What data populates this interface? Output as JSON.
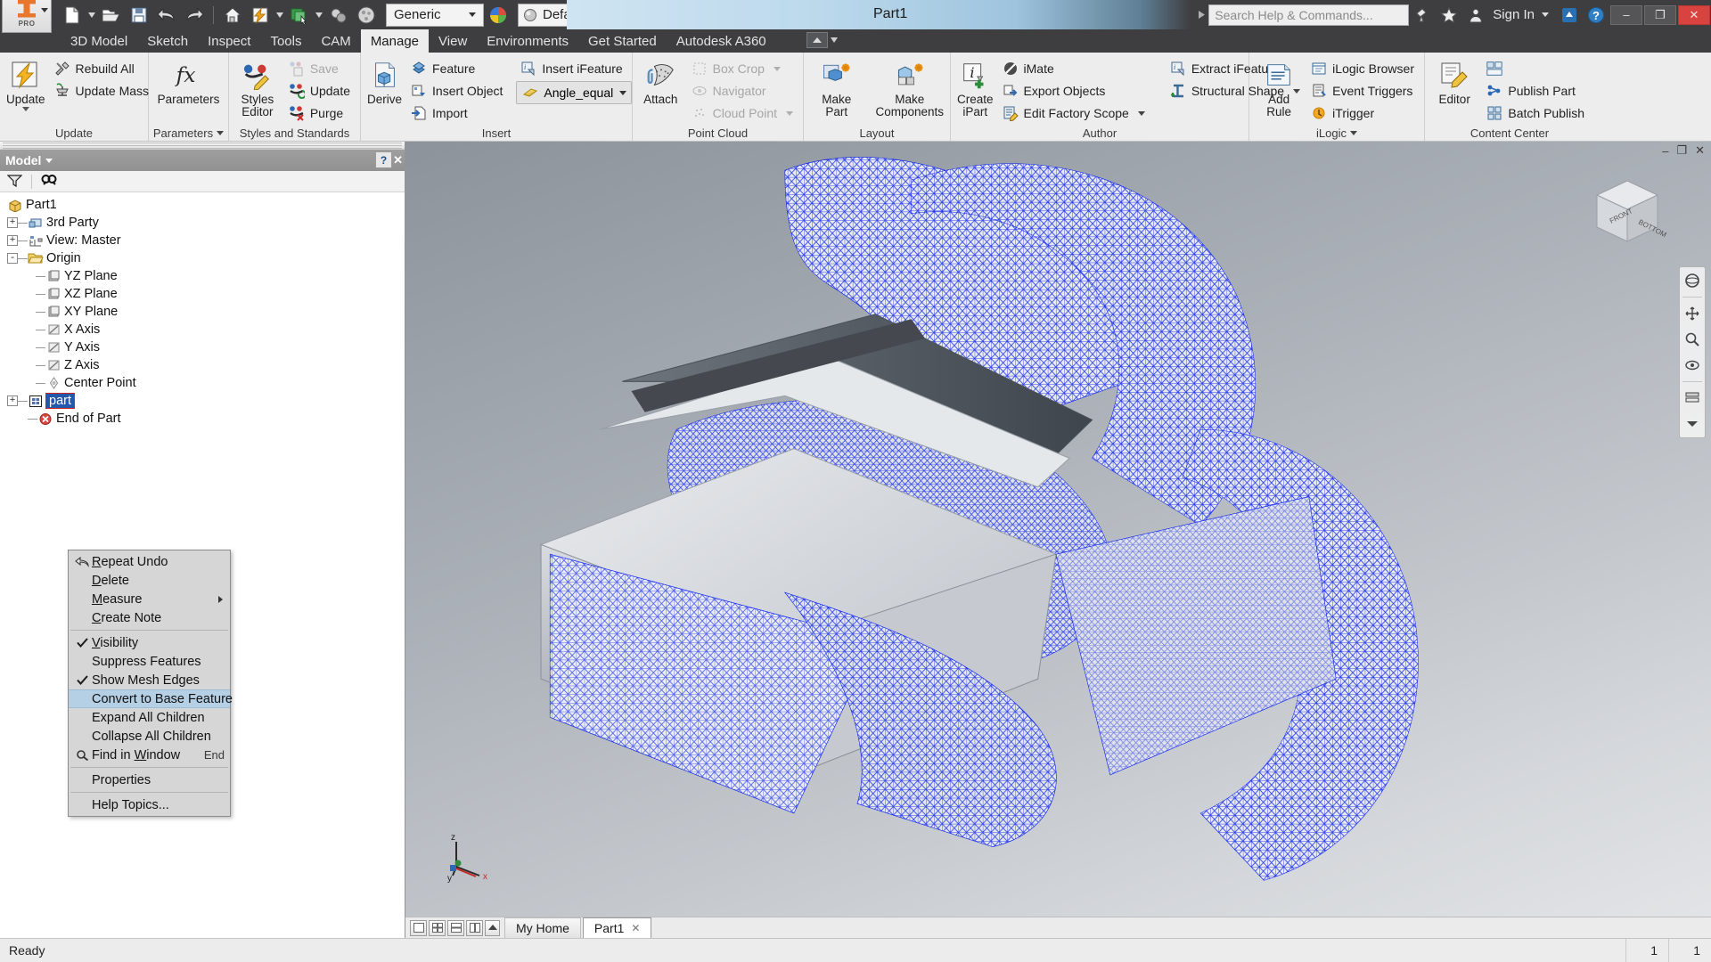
{
  "app": {
    "title": "Part1",
    "logo_label": "PRO"
  },
  "quick_access": {
    "items": [
      {
        "name": "new-file-icon",
        "label": "New"
      },
      {
        "name": "open-file-icon",
        "label": "Open"
      },
      {
        "name": "save-icon",
        "label": "Save"
      },
      {
        "name": "undo-icon",
        "label": "Undo"
      },
      {
        "name": "redo-icon",
        "label": "Redo"
      },
      {
        "name": "home-icon",
        "label": "Home"
      },
      {
        "name": "update-icon",
        "label": "Update"
      },
      {
        "name": "select-icon",
        "label": "Select"
      },
      {
        "name": "appearance-icon",
        "label": "Appearance"
      },
      {
        "name": "material-icon",
        "label": "Material"
      }
    ],
    "material_combo": "Generic",
    "appearance_combo": "Default"
  },
  "titlebar": {
    "search_placeholder": "Search Help & Commands...",
    "sign_in": "Sign In",
    "minimize": "–",
    "maximize": "❐",
    "close": "✕"
  },
  "menu_tabs": [
    {
      "label": "3D Model",
      "active": false
    },
    {
      "label": "Sketch",
      "active": false
    },
    {
      "label": "Inspect",
      "active": false
    },
    {
      "label": "Tools",
      "active": false
    },
    {
      "label": "CAM",
      "active": false
    },
    {
      "label": "Manage",
      "active": true
    },
    {
      "label": "View",
      "active": false
    },
    {
      "label": "Environments",
      "active": false
    },
    {
      "label": "Get Started",
      "active": false
    },
    {
      "label": "Autodesk A360",
      "active": false
    }
  ],
  "ribbon": {
    "panels": [
      {
        "title": "Update",
        "has_dropdown": false,
        "big": [
          {
            "label": "Update",
            "icon": "update-icon",
            "has_caret": true
          }
        ],
        "small": [
          {
            "label": "Rebuild All",
            "icon": "rebuild-all-icon",
            "disabled": false,
            "caret": false
          },
          {
            "label": "Update Mass",
            "icon": "update-mass-icon",
            "disabled": false,
            "caret": false
          }
        ]
      },
      {
        "title": "Parameters",
        "has_dropdown": true,
        "big": [
          {
            "label": "Parameters",
            "icon": "fx-icon",
            "has_caret": false
          }
        ],
        "small": []
      },
      {
        "title": "Styles and Standards",
        "has_dropdown": false,
        "big": [
          {
            "label": "Styles Editor",
            "icon": "styles-editor-icon",
            "has_caret": false
          }
        ],
        "small": [
          {
            "label": "Save",
            "icon": "styles-save-icon",
            "disabled": true,
            "caret": false
          },
          {
            "label": "Update",
            "icon": "styles-update-icon",
            "disabled": false,
            "caret": false
          },
          {
            "label": "Purge",
            "icon": "styles-purge-icon",
            "disabled": false,
            "caret": false
          }
        ]
      },
      {
        "title": "Insert",
        "has_dropdown": false,
        "big": [
          {
            "label": "Derive",
            "icon": "derive-icon",
            "has_caret": false
          }
        ],
        "small": [
          {
            "label": "Feature",
            "icon": "feature-icon",
            "disabled": false,
            "caret": false
          },
          {
            "label": "Insert Object",
            "icon": "insert-object-icon",
            "disabled": false,
            "caret": false
          },
          {
            "label": "Import",
            "icon": "import-icon",
            "disabled": false,
            "caret": false
          }
        ],
        "small2": [
          {
            "label": "Insert iFeature",
            "icon": "insert-ifeature-icon",
            "disabled": false,
            "caret": false
          }
        ],
        "pill": {
          "label": "Angle_equal",
          "icon": "ifeature-yellow-icon"
        }
      },
      {
        "title": "Point Cloud",
        "has_dropdown": false,
        "big": [
          {
            "label": "Attach",
            "icon": "attach-icon",
            "has_caret": false
          }
        ],
        "small": [
          {
            "label": "Box Crop",
            "icon": "box-crop-icon",
            "disabled": true,
            "caret": true
          },
          {
            "label": "Navigator",
            "icon": "navigator-icon",
            "disabled": true,
            "caret": false
          },
          {
            "label": "Cloud Point",
            "icon": "cloud-point-icon",
            "disabled": true,
            "caret": true
          }
        ]
      },
      {
        "title": "Layout",
        "has_dropdown": false,
        "big": [
          {
            "label": "Make Part",
            "icon": "make-part-icon",
            "has_caret": false
          },
          {
            "label": "Make Components",
            "icon": "make-components-icon",
            "has_caret": false
          }
        ],
        "small": []
      },
      {
        "title": "Author",
        "has_dropdown": false,
        "big": [
          {
            "label": "Create iPart",
            "icon": "create-ipart-icon",
            "has_caret": false
          }
        ],
        "small": [
          {
            "label": "iMate",
            "icon": "imate-icon",
            "disabled": false,
            "caret": false
          },
          {
            "label": "Export Objects",
            "icon": "export-objects-icon",
            "disabled": false,
            "caret": false
          },
          {
            "label": "Edit Factory Scope",
            "icon": "edit-factory-scope-icon",
            "disabled": false,
            "caret": true
          }
        ],
        "small2": [
          {
            "label": "Extract iFeature",
            "icon": "extract-ifeature-icon",
            "disabled": false,
            "caret": false
          },
          {
            "label": "Structural Shape",
            "icon": "structural-shape-icon",
            "disabled": false,
            "caret": true
          }
        ]
      },
      {
        "title": "iLogic",
        "has_dropdown": true,
        "big": [
          {
            "label": "Add Rule",
            "icon": "add-rule-icon",
            "has_caret": false
          }
        ],
        "small": [
          {
            "label": "iLogic Browser",
            "icon": "ilogic-browser-icon",
            "disabled": false,
            "caret": false
          },
          {
            "label": "Event Triggers",
            "icon": "event-triggers-icon",
            "disabled": false,
            "caret": false
          },
          {
            "label": "iTrigger",
            "icon": "itrigger-icon",
            "disabled": false,
            "caret": false
          }
        ]
      },
      {
        "title": "Content Center",
        "has_dropdown": false,
        "big": [
          {
            "label": "Editor",
            "icon": "editor-icon",
            "has_caret": false
          }
        ],
        "small": [
          {
            "label": "Publish Part",
            "icon": "publish-part-icon",
            "disabled": false,
            "caret": false
          },
          {
            "label": "Batch Publish",
            "icon": "batch-publish-icon",
            "disabled": false,
            "caret": false
          }
        ],
        "small_top_icon": "content-center-icon"
      }
    ]
  },
  "browser": {
    "panel_title": "Model",
    "help_label": "?",
    "close_label": "✕",
    "tools": [
      {
        "name": "filter-icon",
        "label": "Filter"
      },
      {
        "name": "find-icon",
        "label": "Find"
      }
    ],
    "tree": [
      {
        "label": "Part1",
        "depth": 0,
        "icon": "part-cube-icon",
        "expander": "",
        "selected": false
      },
      {
        "label": "3rd Party",
        "depth": 1,
        "icon": "third-party-icon",
        "expander": "+",
        "selected": false
      },
      {
        "label": "View: Master",
        "depth": 1,
        "icon": "view-master-icon",
        "expander": "+",
        "selected": false
      },
      {
        "label": "Origin",
        "depth": 1,
        "icon": "folder-icon",
        "expander": "-",
        "selected": false
      },
      {
        "label": "YZ Plane",
        "depth": 2,
        "icon": "plane-icon",
        "expander": "",
        "selected": false
      },
      {
        "label": "XZ Plane",
        "depth": 2,
        "icon": "plane-icon",
        "expander": "",
        "selected": false
      },
      {
        "label": "XY Plane",
        "depth": 2,
        "icon": "plane-icon",
        "expander": "",
        "selected": false
      },
      {
        "label": "X Axis",
        "depth": 2,
        "icon": "axis-icon",
        "expander": "",
        "selected": false
      },
      {
        "label": "Y Axis",
        "depth": 2,
        "icon": "axis-icon",
        "expander": "",
        "selected": false
      },
      {
        "label": "Z Axis",
        "depth": 2,
        "icon": "axis-icon",
        "expander": "",
        "selected": false
      },
      {
        "label": "Center Point",
        "depth": 2,
        "icon": "center-point-icon",
        "expander": "",
        "selected": false
      },
      {
        "label": "part",
        "depth": 1,
        "icon": "mesh-feature-icon",
        "expander": "+",
        "selected": true
      },
      {
        "label": "End of Part",
        "depth": 1,
        "icon": "end-of-part-icon",
        "expander": "",
        "selected": false
      }
    ]
  },
  "context_menu": {
    "items": [
      {
        "label": "Repeat Undo",
        "accel": "R",
        "icon": "undo-icon",
        "check": false,
        "shortcut": "",
        "submenu": false,
        "highlight": false,
        "sep_after": false
      },
      {
        "label": "Delete",
        "accel": "D",
        "icon": "",
        "check": false,
        "shortcut": "",
        "submenu": false,
        "highlight": false,
        "sep_after": false
      },
      {
        "label": "Measure",
        "accel": "M",
        "icon": "",
        "check": false,
        "shortcut": "",
        "submenu": true,
        "highlight": false,
        "sep_after": false
      },
      {
        "label": "Create Note",
        "accel": "C",
        "icon": "",
        "check": false,
        "shortcut": "",
        "submenu": false,
        "highlight": false,
        "sep_after": true
      },
      {
        "label": "Visibility",
        "accel": "V",
        "icon": "",
        "check": true,
        "shortcut": "",
        "submenu": false,
        "highlight": false,
        "sep_after": false
      },
      {
        "label": "Suppress Features",
        "accel": "",
        "icon": "",
        "check": false,
        "shortcut": "",
        "submenu": false,
        "highlight": false,
        "sep_after": false
      },
      {
        "label": "Show Mesh Edges",
        "accel": "",
        "icon": "",
        "check": true,
        "shortcut": "",
        "submenu": false,
        "highlight": false,
        "sep_after": false
      },
      {
        "label": "Convert to Base Feature",
        "accel": "",
        "icon": "",
        "check": false,
        "shortcut": "",
        "submenu": false,
        "highlight": true,
        "sep_after": false
      },
      {
        "label": "Expand All Children",
        "accel": "",
        "icon": "",
        "check": false,
        "shortcut": "",
        "submenu": false,
        "highlight": false,
        "sep_after": false
      },
      {
        "label": "Collapse All Children",
        "accel": "",
        "icon": "",
        "check": false,
        "shortcut": "",
        "submenu": false,
        "highlight": false,
        "sep_after": false
      },
      {
        "label": "Find in Window",
        "accel": "W",
        "icon": "find-icon",
        "check": false,
        "shortcut": "End",
        "submenu": false,
        "highlight": false,
        "sep_after": true
      },
      {
        "label": "Properties",
        "accel": "",
        "icon": "",
        "check": false,
        "shortcut": "",
        "submenu": false,
        "highlight": false,
        "sep_after": true
      },
      {
        "label": "Help Topics...",
        "accel": "",
        "icon": "",
        "check": false,
        "shortcut": "",
        "submenu": false,
        "highlight": false,
        "sep_after": false
      }
    ]
  },
  "canvas": {
    "view_labels": {
      "front": "FRONT",
      "bottom": "BOTTOM"
    },
    "axis": {
      "x": "x",
      "y": "y",
      "z": "z"
    }
  },
  "doc_tabs": {
    "tabs": [
      {
        "label": "My Home",
        "active": false,
        "closable": false
      },
      {
        "label": "Part1",
        "active": true,
        "closable": true
      }
    ]
  },
  "statusbar": {
    "message": "Ready",
    "cell1": "1",
    "cell2": "1"
  },
  "colors": {
    "accent": "#2359a8",
    "mesh_blue": "#0b20f0",
    "ribbon_bg": "#ededed",
    "titlebar_bg": "#3e3e40",
    "highlight": "#b5cfe4"
  }
}
